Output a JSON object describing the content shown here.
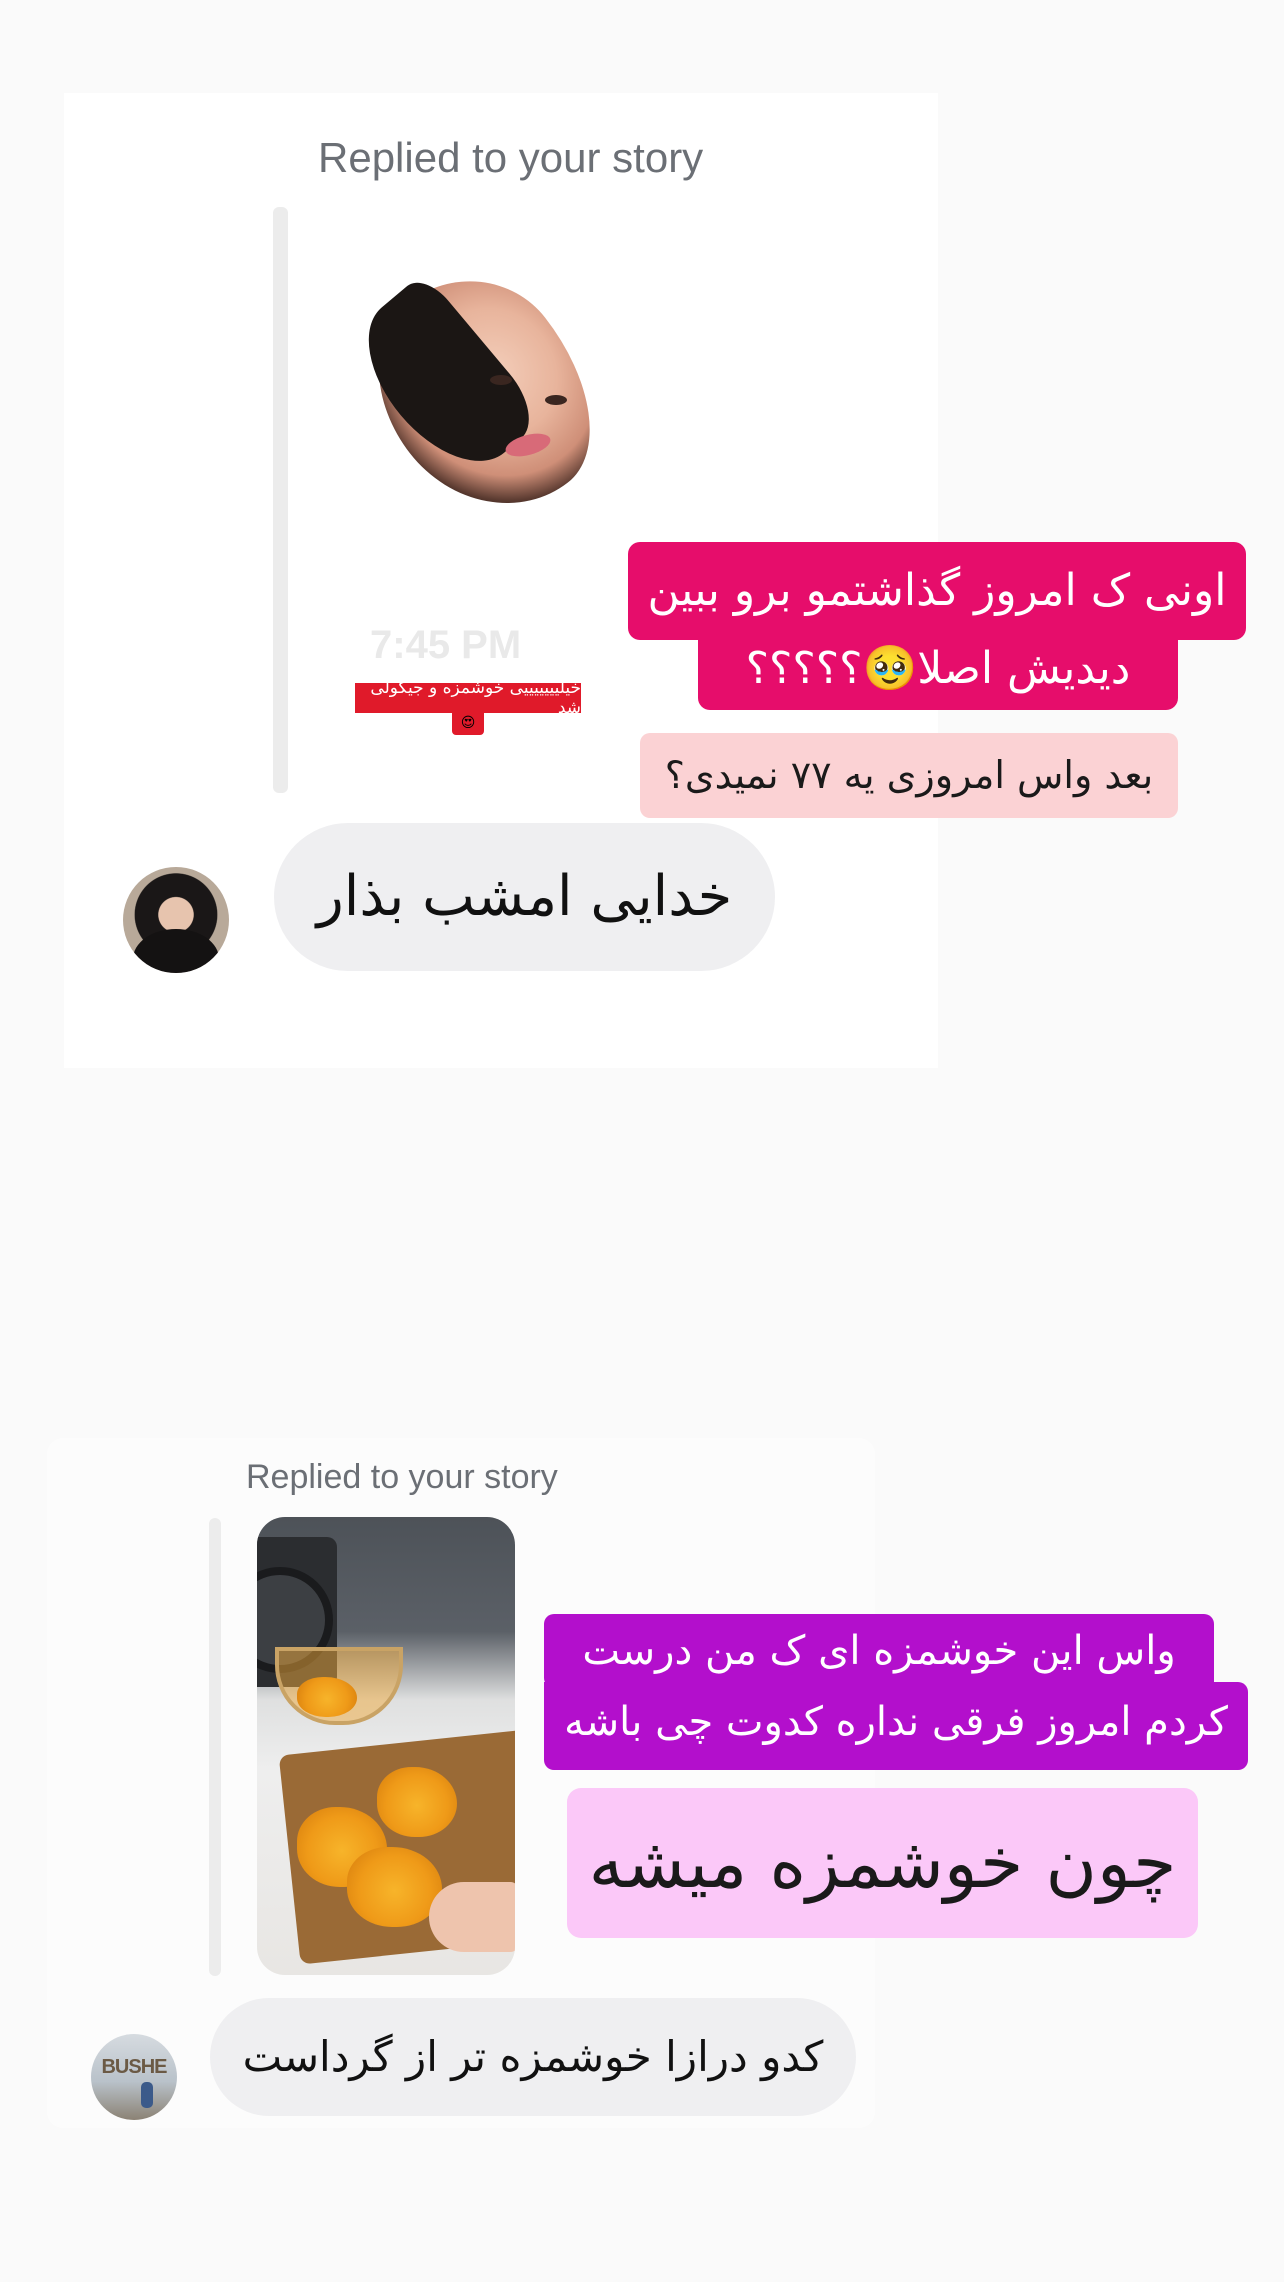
{
  "conversation": [
    {
      "replied_label": "Replied to your story",
      "story": {
        "sticker_time": "7:45 PM",
        "sticker_text": "خیلیییییییی خوشمزه و جیگولی شد",
        "sticker_emoji": "😍",
        "overlay_line_1": "اونی ک امروز گذاشتمو برو ببین",
        "overlay_line_2": "دیدیش اصلا🥹؟؟؟؟؟",
        "overlay_line_3": "بعد واس امروزی یه ۷۷ نمیدی؟"
      },
      "message": "خدایی امشب بذار",
      "avatar": "user-avatar"
    },
    {
      "replied_label": "Replied to your story",
      "story": {
        "overlay_line_1": "واس این خوشمزه ای ک من درست",
        "overlay_line_2": "کردم امروز فرقی نداره کدوت چی باشه",
        "overlay_line_3": "چون خوشمزه میشه"
      },
      "message": "کدو درازا خوشمزه تر از گرداست",
      "avatar": "user-avatar",
      "avatar_sign": "BUSHE"
    }
  ],
  "colors": {
    "overlay_magenta": "#e60d6b",
    "overlay_pink_light": "#fbd2d4",
    "overlay_purple": "#b30fcc",
    "overlay_lilac": "#fbc8f8",
    "bubble_gray": "#efeff1"
  }
}
